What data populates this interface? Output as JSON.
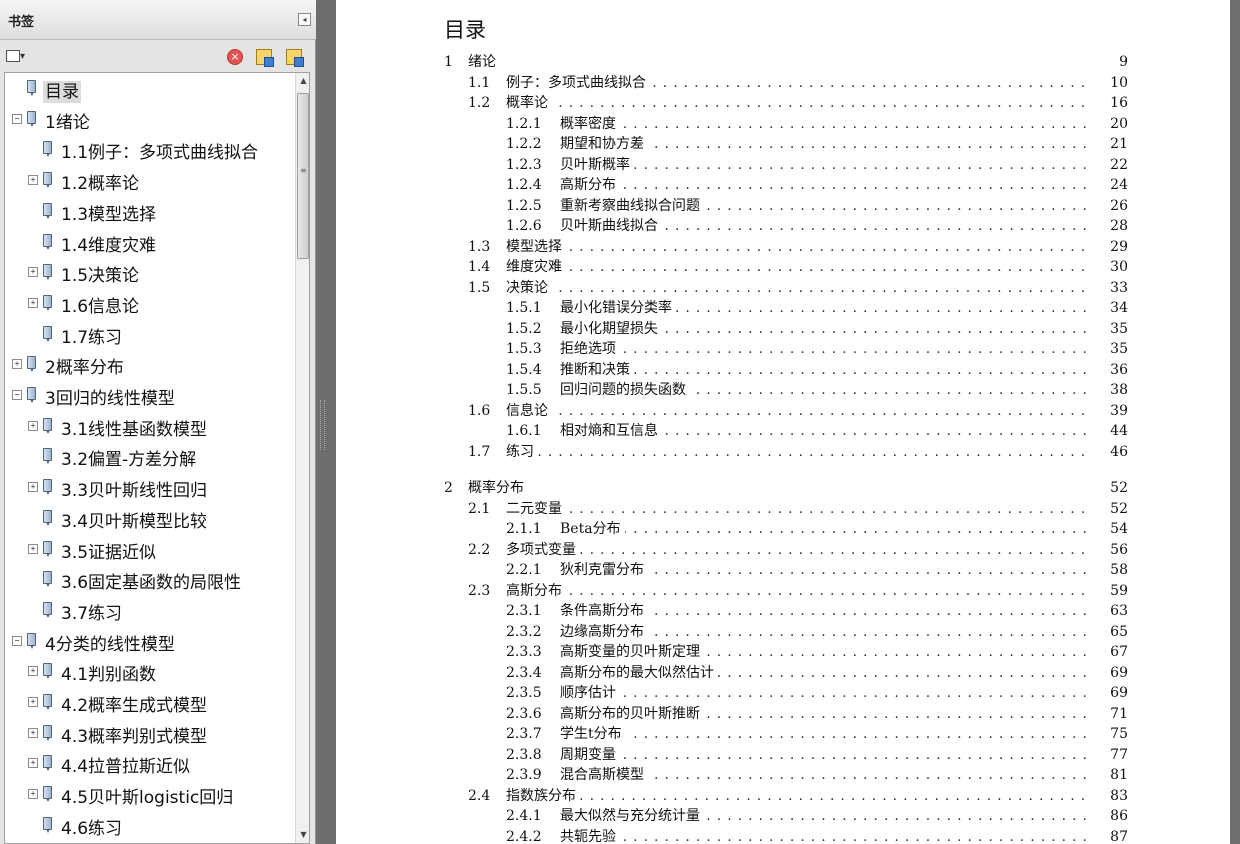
{
  "sidebar": {
    "title": "书签",
    "collapse_glyph": "◂",
    "options_glyph": "▾",
    "delete_glyph": "×",
    "toggle_expand": "+",
    "toggle_collapse": "−",
    "items": [
      {
        "label": "目录",
        "level": 0,
        "toggle": "none",
        "selected": true
      },
      {
        "label": "1绪论",
        "level": 0,
        "toggle": "collapse"
      },
      {
        "label": "1.1例子：多项式曲线拟合",
        "level": 1,
        "toggle": "none"
      },
      {
        "label": "1.2概率论",
        "level": 1,
        "toggle": "expand"
      },
      {
        "label": "1.3模型选择",
        "level": 1,
        "toggle": "none"
      },
      {
        "label": "1.4维度灾难",
        "level": 1,
        "toggle": "none"
      },
      {
        "label": "1.5决策论",
        "level": 1,
        "toggle": "expand"
      },
      {
        "label": "1.6信息论",
        "level": 1,
        "toggle": "expand"
      },
      {
        "label": "1.7练习",
        "level": 1,
        "toggle": "none"
      },
      {
        "label": "2概率分布",
        "level": 0,
        "toggle": "expand"
      },
      {
        "label": "3回归的线性模型",
        "level": 0,
        "toggle": "collapse"
      },
      {
        "label": "3.1线性基函数模型",
        "level": 1,
        "toggle": "expand"
      },
      {
        "label": "3.2偏置-方差分解",
        "level": 1,
        "toggle": "none"
      },
      {
        "label": "3.3贝叶斯线性回归",
        "level": 1,
        "toggle": "expand"
      },
      {
        "label": "3.4贝叶斯模型比较",
        "level": 1,
        "toggle": "none"
      },
      {
        "label": "3.5证据近似",
        "level": 1,
        "toggle": "expand"
      },
      {
        "label": "3.6固定基函数的局限性",
        "level": 1,
        "toggle": "none"
      },
      {
        "label": "3.7练习",
        "level": 1,
        "toggle": "none"
      },
      {
        "label": "4分类的线性模型",
        "level": 0,
        "toggle": "collapse"
      },
      {
        "label": "4.1判别函数",
        "level": 1,
        "toggle": "expand"
      },
      {
        "label": "4.2概率生成式模型",
        "level": 1,
        "toggle": "expand"
      },
      {
        "label": "4.3概率判别式模型",
        "level": 1,
        "toggle": "expand"
      },
      {
        "label": "4.4拉普拉斯近似",
        "level": 1,
        "toggle": "expand"
      },
      {
        "label": "4.5贝叶斯logistic回归",
        "level": 1,
        "toggle": "expand"
      },
      {
        "label": "4.6练习",
        "level": 1,
        "toggle": "none"
      }
    ],
    "scroll_up_glyph": "▲",
    "scroll_down_glyph": "▼",
    "scroll_grip": "≡"
  },
  "document": {
    "title": "目录",
    "toc": [
      {
        "num": "1",
        "title": "绪论",
        "page": "9",
        "level": 0,
        "dots": false
      },
      {
        "num": "1.1",
        "title": "例子：多项式曲线拟合",
        "page": "10",
        "level": 1,
        "dots": true
      },
      {
        "num": "1.2",
        "title": "概率论",
        "page": "16",
        "level": 1,
        "dots": true
      },
      {
        "num": "1.2.1",
        "title": "概率密度",
        "page": "20",
        "level": 2,
        "dots": true
      },
      {
        "num": "1.2.2",
        "title": "期望和协方差",
        "page": "21",
        "level": 2,
        "dots": true
      },
      {
        "num": "1.2.3",
        "title": "贝叶斯概率",
        "page": "22",
        "level": 2,
        "dots": true
      },
      {
        "num": "1.2.4",
        "title": "高斯分布",
        "page": "24",
        "level": 2,
        "dots": true
      },
      {
        "num": "1.2.5",
        "title": "重新考察曲线拟合问题",
        "page": "26",
        "level": 2,
        "dots": true
      },
      {
        "num": "1.2.6",
        "title": "贝叶斯曲线拟合",
        "page": "28",
        "level": 2,
        "dots": true
      },
      {
        "num": "1.3",
        "title": "模型选择",
        "page": "29",
        "level": 1,
        "dots": true
      },
      {
        "num": "1.4",
        "title": "维度灾难",
        "page": "30",
        "level": 1,
        "dots": true
      },
      {
        "num": "1.5",
        "title": "决策论",
        "page": "33",
        "level": 1,
        "dots": true
      },
      {
        "num": "1.5.1",
        "title": "最小化错误分类率",
        "page": "34",
        "level": 2,
        "dots": true
      },
      {
        "num": "1.5.2",
        "title": "最小化期望损失",
        "page": "35",
        "level": 2,
        "dots": true
      },
      {
        "num": "1.5.3",
        "title": "拒绝选项",
        "page": "35",
        "level": 2,
        "dots": true
      },
      {
        "num": "1.5.4",
        "title": "推断和决策",
        "page": "36",
        "level": 2,
        "dots": true
      },
      {
        "num": "1.5.5",
        "title": "回归问题的损失函数",
        "page": "38",
        "level": 2,
        "dots": true
      },
      {
        "num": "1.6",
        "title": "信息论",
        "page": "39",
        "level": 1,
        "dots": true
      },
      {
        "num": "1.6.1",
        "title": "相对熵和互信息",
        "page": "44",
        "level": 2,
        "dots": true
      },
      {
        "num": "1.7",
        "title": "练习",
        "page": "46",
        "level": 1,
        "dots": true
      },
      {
        "num": "2",
        "title": "概率分布",
        "page": "52",
        "level": 0,
        "dots": false
      },
      {
        "num": "2.1",
        "title": "二元变量",
        "page": "52",
        "level": 1,
        "dots": true
      },
      {
        "num": "2.1.1",
        "title": "Beta分布",
        "page": "54",
        "level": 2,
        "dots": true
      },
      {
        "num": "2.2",
        "title": "多项式变量",
        "page": "56",
        "level": 1,
        "dots": true
      },
      {
        "num": "2.2.1",
        "title": "狄利克雷分布",
        "page": "58",
        "level": 2,
        "dots": true
      },
      {
        "num": "2.3",
        "title": "高斯分布",
        "page": "59",
        "level": 1,
        "dots": true
      },
      {
        "num": "2.3.1",
        "title": "条件高斯分布",
        "page": "63",
        "level": 2,
        "dots": true
      },
      {
        "num": "2.3.2",
        "title": "边缘高斯分布",
        "page": "65",
        "level": 2,
        "dots": true
      },
      {
        "num": "2.3.3",
        "title": "高斯变量的贝叶斯定理",
        "page": "67",
        "level": 2,
        "dots": true
      },
      {
        "num": "2.3.4",
        "title": "高斯分布的最大似然估计",
        "page": "69",
        "level": 2,
        "dots": true
      },
      {
        "num": "2.3.5",
        "title": "顺序估计",
        "page": "69",
        "level": 2,
        "dots": true
      },
      {
        "num": "2.3.6",
        "title": "高斯分布的贝叶斯推断",
        "page": "71",
        "level": 2,
        "dots": true
      },
      {
        "num": "2.3.7",
        "title": "学生t分布",
        "page": "75",
        "level": 2,
        "dots": true
      },
      {
        "num": "2.3.8",
        "title": "周期变量",
        "page": "77",
        "level": 2,
        "dots": true
      },
      {
        "num": "2.3.9",
        "title": "混合高斯模型",
        "page": "81",
        "level": 2,
        "dots": true
      },
      {
        "num": "2.4",
        "title": "指数族分布",
        "page": "83",
        "level": 1,
        "dots": true
      },
      {
        "num": "2.4.1",
        "title": "最大似然与充分统计量",
        "page": "86",
        "level": 2,
        "dots": true
      },
      {
        "num": "2.4.2",
        "title": "共轭先验",
        "page": "87",
        "level": 2,
        "dots": true
      }
    ]
  }
}
